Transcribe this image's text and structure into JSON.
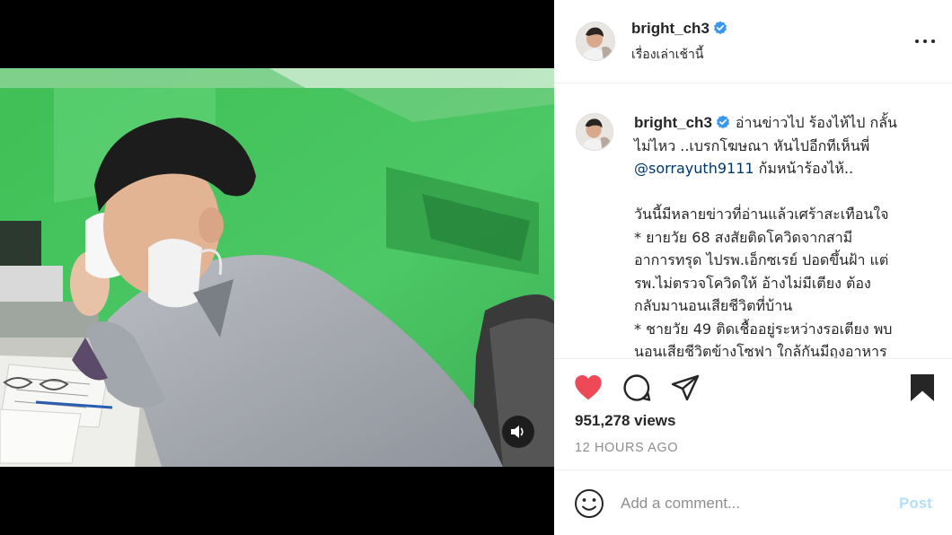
{
  "post": {
    "username": "bright_ch3",
    "location": "เรื่องเล่าเช้านี้",
    "verified": true
  },
  "caption": {
    "username": "bright_ch3",
    "lines": [
      "อ่านข่าวไป ร้องไห้ไป กลั้น",
      "ไม่ไหว ..เบรกโฆษณา หันไปอีกทีเห็นพี่",
      "@sorrayuth9111",
      "ก้มหน้าร้องไห้..",
      "",
      "วันนี้มีหลายข่าวที่อ่านแล้วเศร้าสะเทือนใจ",
      "* ยายวัย 68 สงสัยติดโควิดจากสามี",
      "อาการทรุด ไปรพ.เอ็กซเรย์ ปอดขึ้นฝ้า แต่",
      "รพ.ไม่ตรวจโควิดให้ อ้างไม่มีเตียง ต้อง",
      "กลับมานอนเสียชีวิตที่บ้าน",
      "* ชายวัย 49 ติดเชื้ออยู่ระหว่างรอเตียง พบ",
      "นอนเสียชีวิตข้างโซฟา ใกล้กันมีถุงอาหาร"
    ]
  },
  "stats": {
    "views": "951,278 views",
    "timestamp": "12 HOURS AGO"
  },
  "comment": {
    "placeholder": "Add a comment...",
    "post_label": "Post"
  },
  "icons": {
    "like": "heart-filled-icon",
    "comment": "comment-bubble-icon",
    "share": "paper-plane-icon",
    "save": "bookmark-filled-icon",
    "more": "more-horizontal-icon",
    "mute": "speaker-icon",
    "emoji": "smiley-icon"
  },
  "colors": {
    "like_red": "#ed4956",
    "verified_blue": "#3897f0",
    "mention_blue": "#00376b",
    "post_disabled": "#b2dffc",
    "muted_text": "#8e8e8e"
  }
}
